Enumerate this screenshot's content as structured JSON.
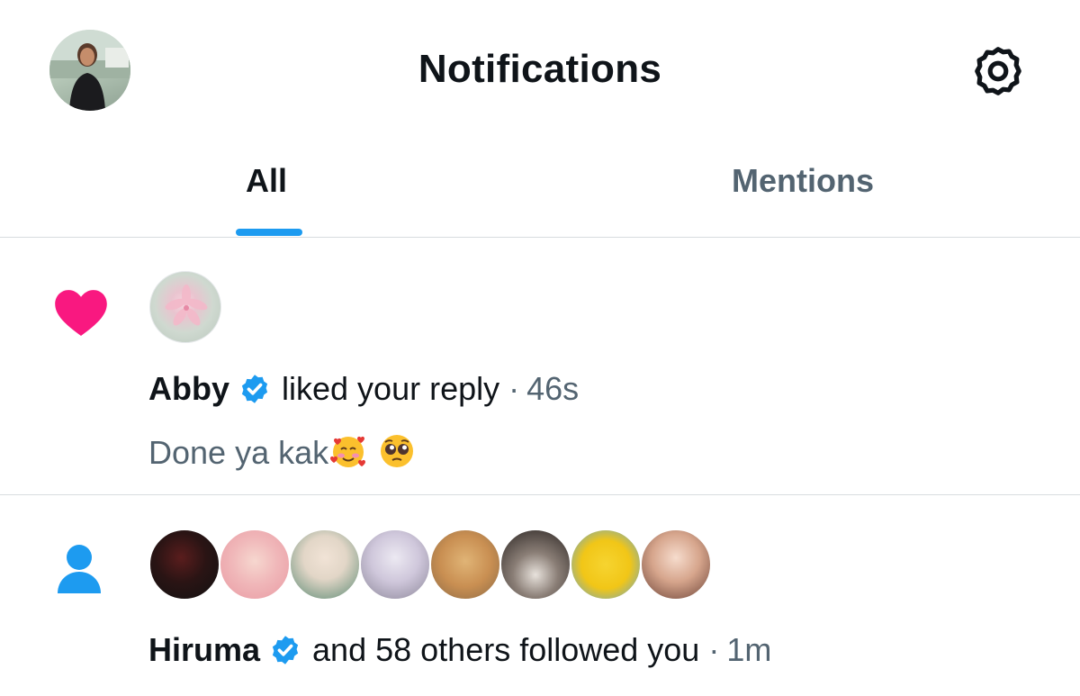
{
  "header": {
    "title": "Notifications",
    "self_avatar_icon": "profile-avatar",
    "settings_icon": "gear-icon"
  },
  "tabs": [
    {
      "label": "All",
      "active": true
    },
    {
      "label": "Mentions",
      "active": false
    }
  ],
  "notifications": [
    {
      "type_icon": "heart-icon",
      "type_color": "#f91880",
      "actor": "Abby",
      "verified": true,
      "action": "liked your reply",
      "separator": "·",
      "time": "46s",
      "content": "Done ya kak",
      "content_emojis": [
        "smiling-face-with-hearts",
        "pleading-face"
      ]
    },
    {
      "type_icon": "person-icon",
      "type_color": "#1d9bf0",
      "actor": "Hiruma",
      "verified": true,
      "action": "and 58 others followed you",
      "separator": "·",
      "time": "1m",
      "follower_avatars": 8
    }
  ],
  "colors": {
    "accent": "#1d9bf0",
    "like": "#f91880",
    "text_primary": "#0f1419",
    "text_secondary": "#536471",
    "divider": "#d8dcdf"
  }
}
